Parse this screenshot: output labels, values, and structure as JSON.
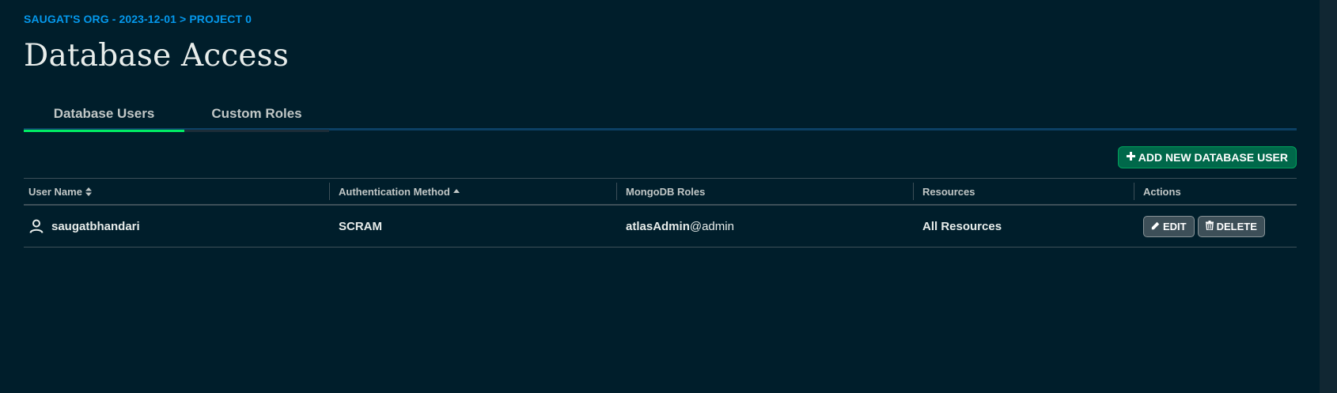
{
  "breadcrumb": "SAUGAT'S ORG - 2023-12-01 > PROJECT 0",
  "page_title": "Database Access",
  "tabs": [
    {
      "label": "Database Users",
      "active": true
    },
    {
      "label": "Custom Roles",
      "active": false
    }
  ],
  "add_button": {
    "icon": "plus-icon",
    "label": "ADD NEW DATABASE USER"
  },
  "table": {
    "headers": {
      "user_name": "User Name",
      "auth_method": "Authentication Method",
      "roles": "MongoDB Roles",
      "resources": "Resources",
      "actions": "Actions"
    },
    "rows": [
      {
        "user_icon": "user-icon",
        "user_name": "saugatbhandari",
        "auth_method": "SCRAM",
        "role_name": "atlasAdmin",
        "role_db": "@admin",
        "resources": "All Resources",
        "edit_label": "EDIT",
        "delete_label": "DELETE"
      }
    ]
  },
  "colors": {
    "background": "#001e2b",
    "accent_link": "#0498ec",
    "tab_active_underline": "#00ed64",
    "primary_button": "#00684a"
  }
}
